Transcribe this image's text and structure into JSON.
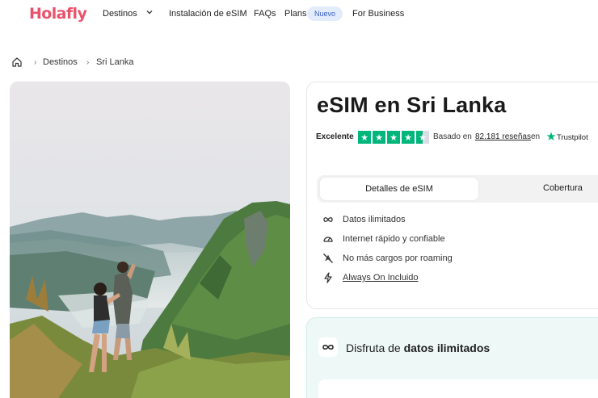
{
  "nav": {
    "logo": "Holafly",
    "destinos": "Destinos",
    "instalacion": "Instalación de eSIM",
    "faqs": "FAQs",
    "plans": "Plans",
    "nuevo_badge": "Nuevo",
    "for_business": "For Business"
  },
  "breadcrumb": {
    "items": [
      "Destinos",
      "Sri Lanka"
    ]
  },
  "product": {
    "title": "eSIM en Sri Lanka",
    "rating_label": "Excelente",
    "rating_stars": 4.5,
    "based_on": "Basado en",
    "reviews": "82.181 reseñas",
    "en": "en",
    "trustpilot": "Trustpilot",
    "tabs": [
      "Detalles de eSIM",
      "Cobertura"
    ],
    "features": [
      {
        "icon": "infinity-icon",
        "text": "Datos ilimitados"
      },
      {
        "icon": "speedometer-icon",
        "text": "Internet rápido y confiable"
      },
      {
        "icon": "no-roaming-icon",
        "text": "No más cargos por roaming"
      },
      {
        "icon": "lightning-icon",
        "text": "Always On Incluido"
      }
    ]
  },
  "promo": {
    "prefix": "Disfruta de",
    "bold": "datos ilimitados"
  },
  "colors": {
    "brand": "#e9526b",
    "trustpilot_green": "#00b67a",
    "badge_bg": "#e3ecfb",
    "promo_bg": "#eef8f7"
  }
}
